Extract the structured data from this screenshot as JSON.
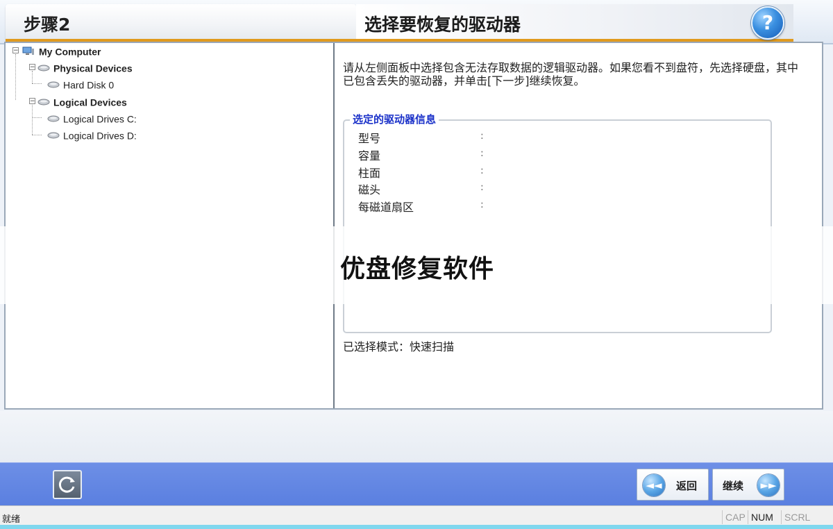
{
  "header": {
    "step_label": "步骤2",
    "title": "选择要恢复的驱动器",
    "help_glyph": "?"
  },
  "tree": {
    "root": "My Computer",
    "physical_devices": "Physical Devices",
    "hard_disk": "Hard Disk 0",
    "logical_devices": "Logical Devices",
    "drive_c": "Logical Drives C:",
    "drive_d": "Logical Drives D:"
  },
  "right_pane": {
    "instructions": "请从左侧面板中选择包含无法存取数据的逻辑驱动器。如果您看不到盘符，先选择硬盘，其中已包含丢失的驱动器，并单击[下一步]继续恢复。",
    "group_title": "选定的驱动器信息",
    "fields": [
      {
        "label": "型号",
        "value": ":"
      },
      {
        "label": "容量",
        "value": ":"
      },
      {
        "label": "柱面",
        "value": ":"
      },
      {
        "label": "磁头",
        "value": ":"
      },
      {
        "label": "每磁道扇区",
        "value": ":"
      }
    ],
    "mode_line": "已选择模式：快速扫描"
  },
  "watermark": {
    "text": "优盘修复软件"
  },
  "bottom_bar": {
    "back_label": "返回",
    "continue_label": "继续"
  },
  "status_bar": {
    "status": "就绪",
    "indicators": {
      "cap": "CAP",
      "num": "NUM",
      "scrl": "SCRL"
    }
  },
  "colors": {
    "accent_orange": "#e09a1e",
    "bottom_bar_blue": "#5a7fe0",
    "group_title_blue": "#1a31c9"
  },
  "icons": {
    "help": "question-mark-icon",
    "refresh": "refresh-icon",
    "back": "double-chevron-left-icon",
    "continue": "double-chevron-right-icon",
    "computer": "computer-icon",
    "drive": "drive-icon"
  }
}
